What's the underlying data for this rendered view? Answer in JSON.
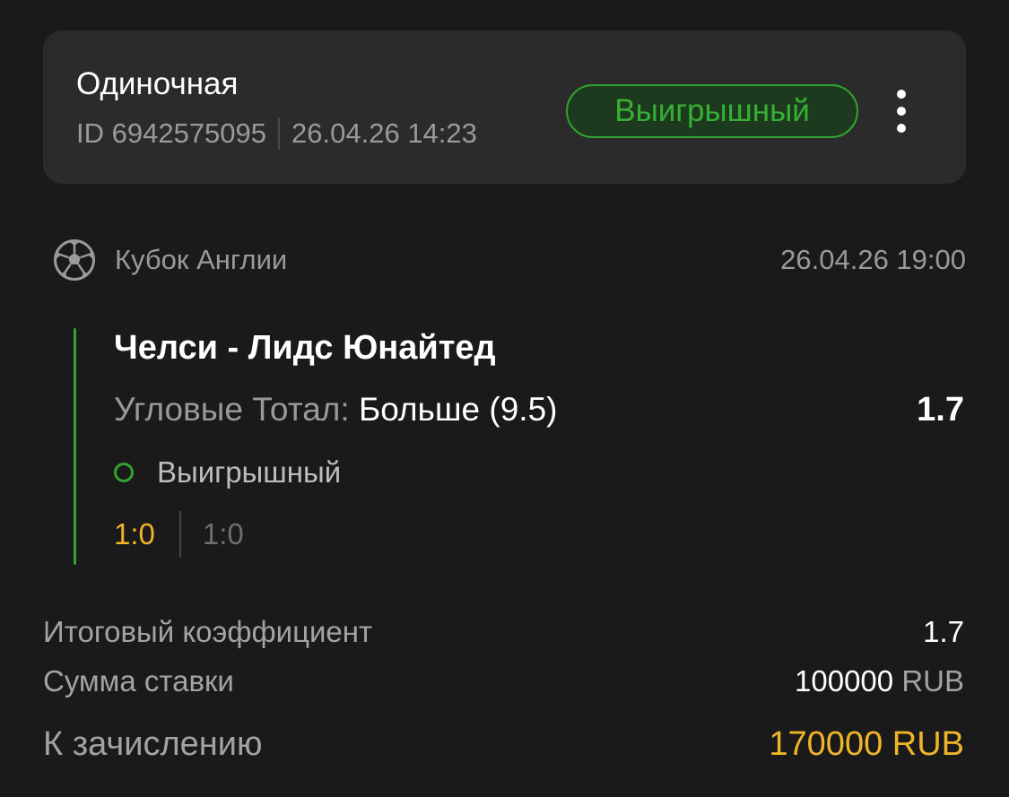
{
  "bet": {
    "type": "Одиночная",
    "id_label": "ID 6942575095",
    "placed_at": "26.04.26 14:23",
    "status": "Выигрышный"
  },
  "event": {
    "sport_icon": "soccer-ball-icon",
    "league": "Кубок Англии",
    "start_time": "26.04.26 19:00",
    "match": "Челси - Лидс Юнайтед",
    "market_label": "Угловые Тотал:",
    "selection": "Больше (9.5)",
    "odds": "1.7",
    "result": "Выигрышный",
    "score_final": "1:0",
    "score_half": "1:0"
  },
  "summary": {
    "total_odds_label": "Итоговый коэффициент",
    "total_odds_value": "1.7",
    "stake_label": "Сумма ставки",
    "stake_amount": "100000",
    "stake_currency": "RUB",
    "payout_label": "К зачислению",
    "payout_value": "170000 RUB"
  },
  "colors": {
    "background": "#1a1a1a",
    "card": "#2b2b2b",
    "win_green": "#2fa52f",
    "accent_yellow": "#f0b429",
    "muted_text": "#9a9a9a"
  }
}
